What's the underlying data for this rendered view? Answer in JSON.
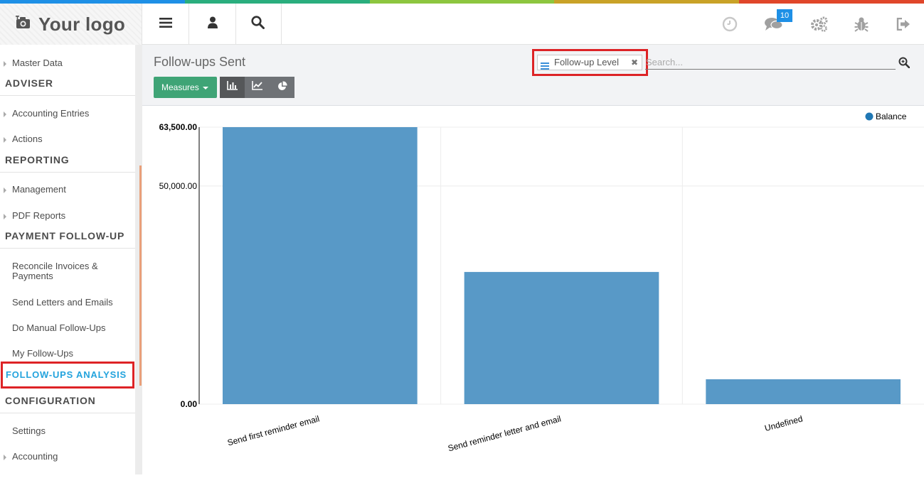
{
  "topbar": {
    "stripe_colors": [
      "#1e90e6",
      "#2aae7e",
      "#8dc63f",
      "#c9a227",
      "#e0462a"
    ],
    "logo_text": "Your logo",
    "logo_icon": "camera-icon",
    "left_buttons": [
      "menu-icon",
      "user-icon",
      "search-icon"
    ],
    "right_icons": [
      "clock-icon",
      "chat-icon",
      "gears-icon",
      "bug-icon",
      "logout-icon"
    ],
    "message_badge": "10"
  },
  "sidebar": {
    "items": [
      {
        "type": "item",
        "label": "Master Data",
        "arrow": true
      },
      {
        "type": "header",
        "label": "ADVISER"
      },
      {
        "type": "item",
        "label": "Accounting Entries",
        "arrow": true
      },
      {
        "type": "item",
        "label": "Actions",
        "arrow": true
      },
      {
        "type": "header",
        "label": "REPORTING"
      },
      {
        "type": "item",
        "label": "Management",
        "arrow": true
      },
      {
        "type": "item",
        "label": "PDF Reports",
        "arrow": true
      },
      {
        "type": "header",
        "label": "PAYMENT FOLLOW-UP"
      },
      {
        "type": "item",
        "label": "Reconcile Invoices &",
        "label2": "Payments",
        "arrow": false
      },
      {
        "type": "item",
        "label": "Send Letters and Emails",
        "arrow": false
      },
      {
        "type": "item",
        "label": "Do Manual Follow-Ups",
        "arrow": false
      },
      {
        "type": "item",
        "label": "My Follow-Ups",
        "arrow": false
      },
      {
        "type": "active",
        "label": "FOLLOW-UPS ANALYSIS"
      },
      {
        "type": "header",
        "label": "CONFIGURATION"
      },
      {
        "type": "item",
        "label": "Settings",
        "arrow": false
      },
      {
        "type": "item",
        "label": "Accounting",
        "arrow": true
      }
    ]
  },
  "control": {
    "title": "Follow-ups Sent",
    "measures_label": "Measures",
    "view_buttons": [
      "bar-chart-icon",
      "line-chart-icon",
      "pie-chart-icon"
    ],
    "active_view": "bar-chart-icon",
    "facet_label": "Follow-up Level",
    "search_placeholder": "Search..."
  },
  "colors": {
    "accent_green": "#3fa476",
    "bar": "#5899c7",
    "legend_dot": "#1f77b4",
    "highlight_red": "#dd2326",
    "active_menu": "#23a3dd"
  },
  "chart_data": {
    "type": "bar",
    "categories": [
      "Send first reminder email",
      "Send reminder letter and email",
      "Undefined"
    ],
    "series": [
      {
        "name": "Balance",
        "values": [
          63500,
          30300,
          5700
        ]
      }
    ],
    "yticks": [
      "0.00",
      "50,000.00",
      "63,500.00"
    ],
    "ytick_values": [
      0,
      50000,
      63500
    ],
    "ylim": [
      0,
      63500
    ],
    "legend_position": "top-right",
    "grid": true
  }
}
